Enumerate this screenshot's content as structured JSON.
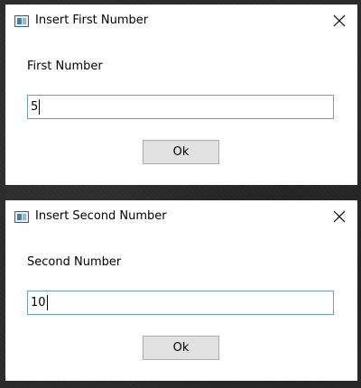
{
  "dialogs": [
    {
      "title": "Insert First Number",
      "label": "First Number",
      "input_value": "5",
      "ok_label": "Ok"
    },
    {
      "title": "Insert Second Number",
      "label": "Second Number",
      "input_value": "10",
      "ok_label": "Ok"
    }
  ],
  "icons": {
    "app": "window-app-icon",
    "close": "close-icon"
  },
  "colors": {
    "input_border": "#6f9bbf",
    "button_bg": "#e1e1e1",
    "button_border": "#adadad",
    "dialog_bg": "#ffffff"
  }
}
